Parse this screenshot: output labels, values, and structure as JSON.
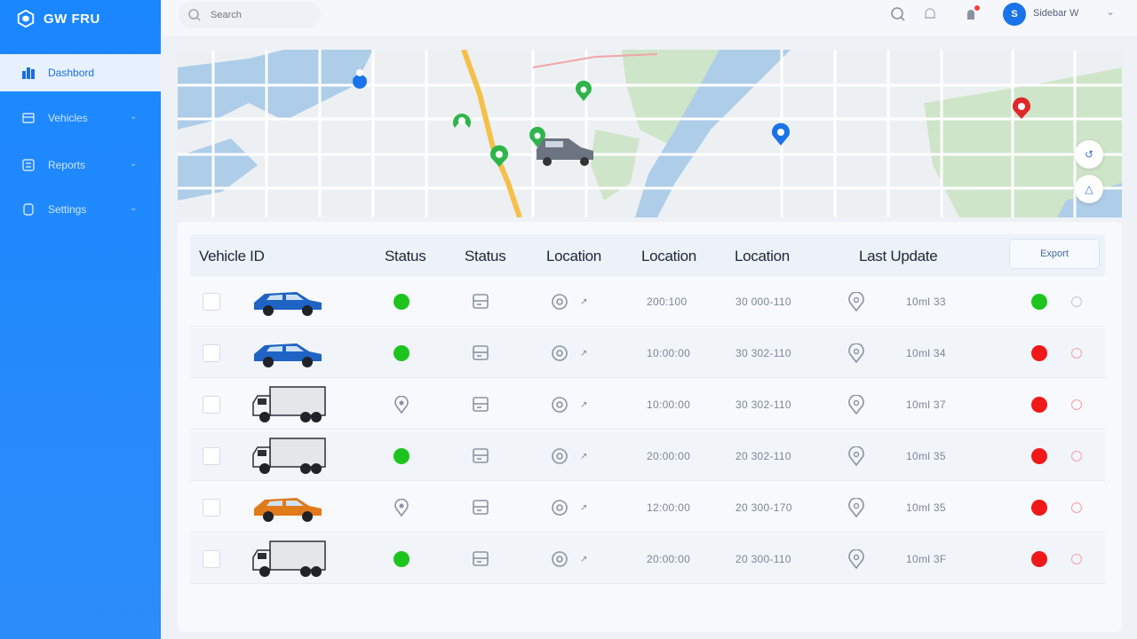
{
  "app": {
    "brand": "GW FRU"
  },
  "sidebar": {
    "items": [
      {
        "label": "Dashbord",
        "active": true,
        "icon": "dashboard-icon"
      },
      {
        "label": "Vehicles",
        "active": false,
        "icon": "vehicles-icon"
      },
      {
        "label": "Reports",
        "active": false,
        "icon": "reports-icon"
      },
      {
        "label": "Settings",
        "active": false,
        "icon": "settings-icon"
      }
    ]
  },
  "topbar": {
    "search_placeholder": "Search",
    "avatar_initials": "S",
    "user_name": "Sidebar W"
  },
  "table": {
    "headers": [
      "Vehicle ID",
      "Status",
      "Status",
      "Location",
      "Location",
      "Location",
      "Last Update"
    ],
    "export_label": "Export",
    "rows": [
      {
        "vehicle": "blue-car",
        "status": "green",
        "col3": "200:100",
        "col4": "30 000-110",
        "col5": "10ml 33",
        "state": "green"
      },
      {
        "vehicle": "blue-car",
        "status": "green",
        "col3": "10:00:00",
        "col4": "30 302-110",
        "col5": "10ml 34",
        "state": "red"
      },
      {
        "vehicle": "truck",
        "status": "pin",
        "col3": "10:00:00",
        "col4": "30 302-110",
        "col5": "10ml 37",
        "state": "red"
      },
      {
        "vehicle": "truck",
        "status": "green",
        "col3": "20:00:00",
        "col4": "20 302-110",
        "col5": "10ml 35",
        "state": "red"
      },
      {
        "vehicle": "orange-car",
        "status": "pin",
        "col3": "12:00:00",
        "col4": "20 300-170",
        "col5": "10ml 35",
        "state": "red"
      },
      {
        "vehicle": "truck",
        "status": "green",
        "col3": "20:00:00",
        "col4": "20 300-110",
        "col5": "10ml 3F",
        "state": "red"
      }
    ]
  },
  "colors": {
    "accent": "#1a86ff",
    "green": "#1ec41e",
    "red": "#f01818",
    "blue_car": "#1f63c4",
    "orange_car": "#e07a1a"
  }
}
